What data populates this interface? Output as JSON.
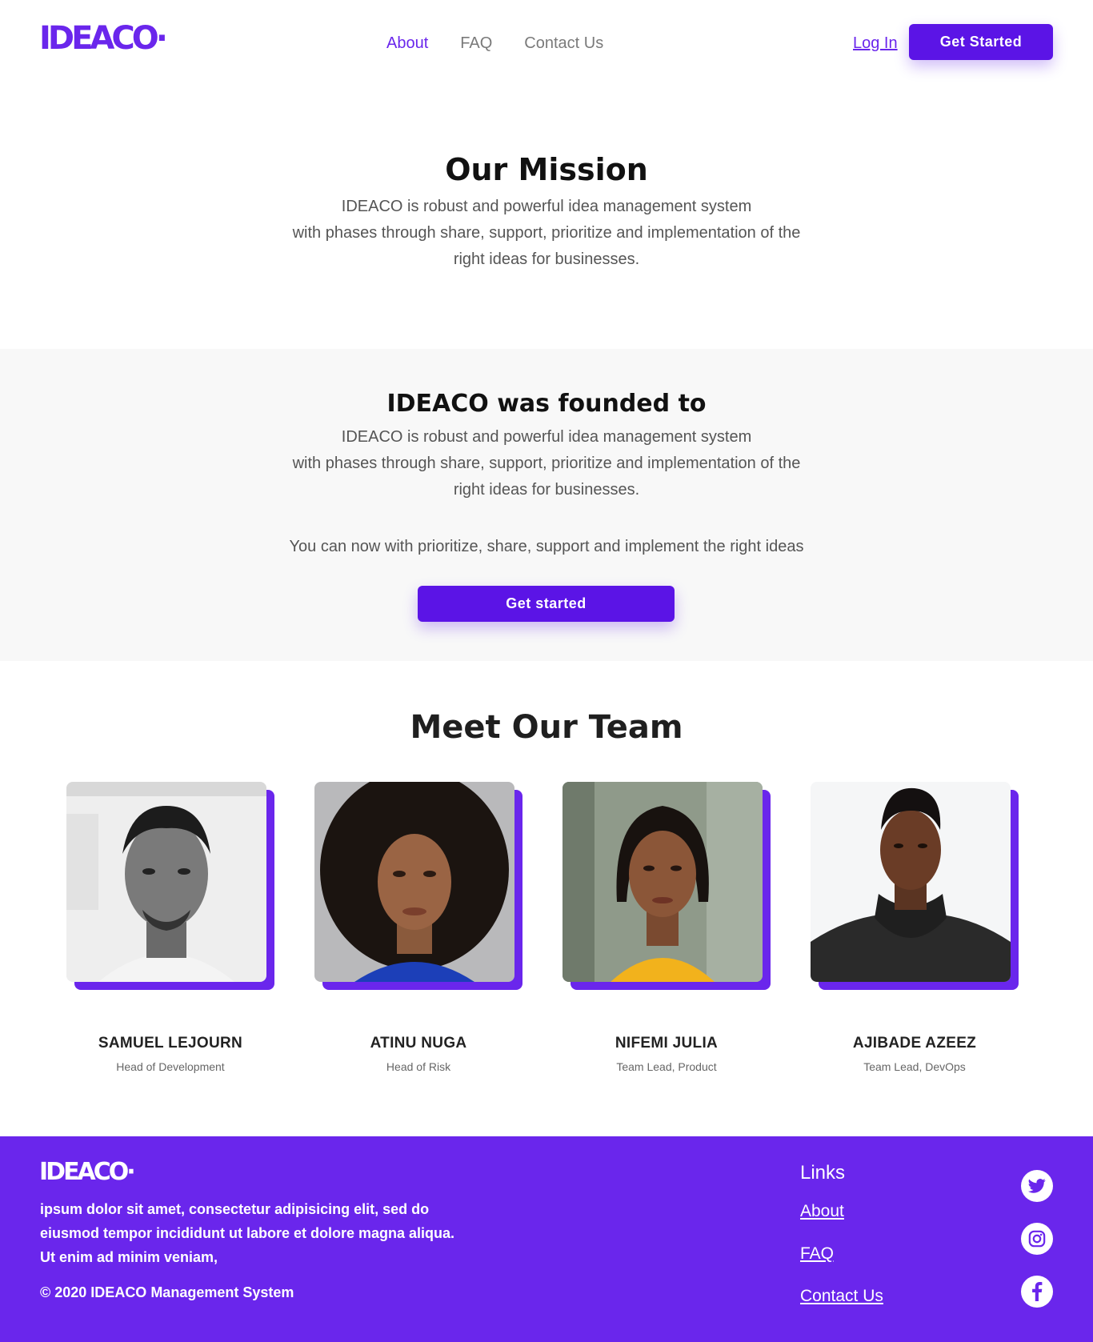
{
  "brand": {
    "name": "IDEACO",
    "accent": "#6a26ec",
    "button": "#5b14e6"
  },
  "header": {
    "nav": [
      {
        "label": "About",
        "active": true
      },
      {
        "label": "FAQ",
        "active": false
      },
      {
        "label": "Contact Us",
        "active": false
      }
    ],
    "login_label": "Log In",
    "cta_label": "Get Started"
  },
  "mission": {
    "title": "Our Mission",
    "lines": [
      "IDEACO is robust and powerful idea management system",
      "with phases through share, support, prioritize and implementation of the",
      "right ideas for businesses."
    ]
  },
  "founded": {
    "title": "IDEACO was founded to",
    "lines": [
      "IDEACO is robust and powerful idea management system",
      "with phases through share, support, prioritize and implementation of the",
      "right ideas for businesses."
    ],
    "tagline": "You can now with prioritize, share, support and implement the right ideas",
    "cta_label": "Get started"
  },
  "team": {
    "title": "Meet Our Team",
    "members": [
      {
        "name": "SAMUEL LEJOURN",
        "role": "Head of Development",
        "photo": "portrait-bw"
      },
      {
        "name": "ATINU NUGA",
        "role": "Head of Risk",
        "photo": "portrait-curly-blue"
      },
      {
        "name": "NIFEMI JULIA",
        "role": "Team Lead, Product",
        "photo": "portrait-yellow"
      },
      {
        "name": "AJIBADE AZEEZ",
        "role": "Team Lead, DevOps",
        "photo": "portrait-black-scarf"
      }
    ]
  },
  "footer": {
    "logo": "IDEACO",
    "text": "ipsum dolor sit amet, consectetur adipisicing elit, sed do eiusmod tempor incididunt ut labore et dolore magna aliqua. Ut enim ad minim veniam,",
    "copyright": "© 2020 IDEACO Management System",
    "links_title": "Links",
    "links": [
      "About",
      "FAQ",
      "Contact Us"
    ],
    "social": [
      "twitter-icon",
      "instagram-icon",
      "facebook-icon"
    ]
  }
}
